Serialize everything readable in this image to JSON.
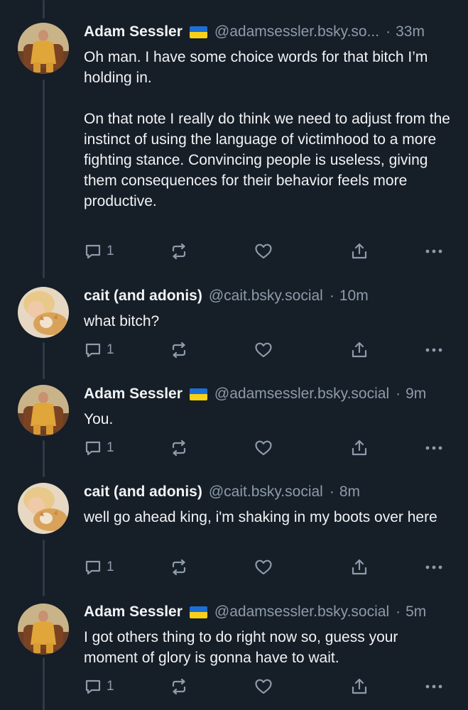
{
  "colors": {
    "background": "#161e27",
    "text_primary": "#f1f3f5",
    "text_secondary": "#8d9bab",
    "thread_line": "#2e3a48"
  },
  "icons": {
    "reply": "reply-icon",
    "repost": "repost-icon",
    "like": "heart-icon",
    "share": "share-icon",
    "more": "more-icon"
  },
  "posts": [
    {
      "author": "Adam Sessler",
      "has_flag": true,
      "handle": "@adamsessler.bsky.so...",
      "time": "33m",
      "text": "Oh man. I have some choice words for that bitch I’m holding in.\n\nOn that note I really do think we need to adjust from the instinct of using the language of victimhood to a more fighting stance. Convincing people is useless, giving them consequences for their behavior feels more productive.",
      "reply_count": "1"
    },
    {
      "author": "cait (and adonis)",
      "has_flag": false,
      "handle": "@cait.bsky.social",
      "time": "10m",
      "text": "what bitch?",
      "reply_count": "1"
    },
    {
      "author": "Adam Sessler",
      "has_flag": true,
      "handle": "@adamsessler.bsky.social",
      "time": "9m",
      "text": "You.",
      "reply_count": "1"
    },
    {
      "author": "cait (and adonis)",
      "has_flag": false,
      "handle": "@cait.bsky.social",
      "time": "8m",
      "text": "well go ahead king, i'm shaking in my boots over here",
      "reply_count": "1"
    },
    {
      "author": "Adam Sessler",
      "has_flag": true,
      "handle": "@adamsessler.bsky.social",
      "time": "5m",
      "text": "I got others thing to do right now so, guess your moment of glory is gonna have to wait.",
      "reply_count": "1"
    }
  ]
}
